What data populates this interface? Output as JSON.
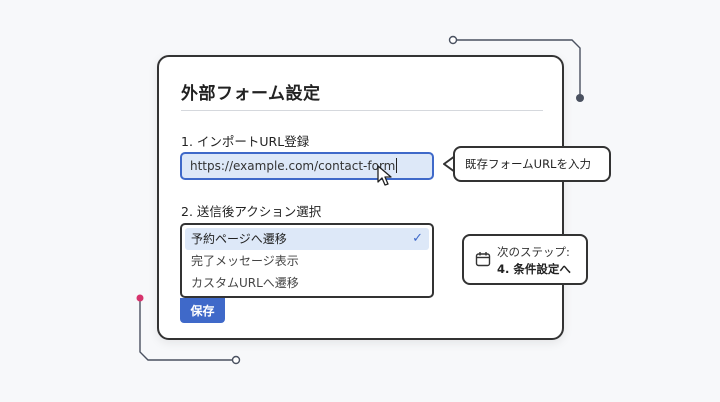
{
  "form": {
    "title": "外部フォーム設定",
    "step1_label": "1. インポートURL登録",
    "url_value": "https://example.com/contact-form",
    "step2_label": "2. 送信後アクション選択",
    "options": [
      {
        "label": "予約ページへ遷移",
        "selected": true
      },
      {
        "label": "完了メッセージ表示",
        "selected": false
      },
      {
        "label": "カスタムURLへ遷移",
        "selected": false
      }
    ],
    "check_mark": "✓",
    "save_label": "保存"
  },
  "tooltip": {
    "text": "既存フォームURLを入力"
  },
  "next_step": {
    "label": "次のステップ:",
    "step": "4. 条件設定へ"
  },
  "colors": {
    "accent": "#3f69c9",
    "highlight": "#dde8f8",
    "deco_pink": "#d6336c",
    "deco_dark": "#4a5160"
  }
}
